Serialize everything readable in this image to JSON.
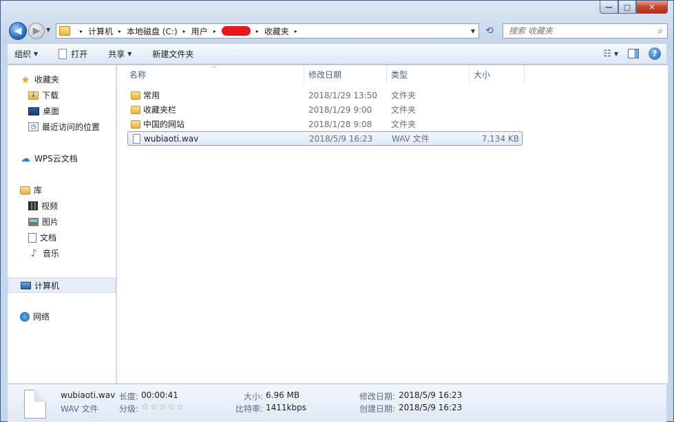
{
  "window": {
    "min_label": "—",
    "max_label": "□",
    "close_label": "✕"
  },
  "nav": {
    "back_icon": "◀",
    "forward_icon": "▶",
    "history_icon": "▼"
  },
  "address": {
    "crumbs": [
      "计算机",
      "本地磁盘 (C:)",
      "用户",
      "收藏夹"
    ],
    "separator": "▸",
    "dropdown_icon": "▼"
  },
  "refresh_icon": "⟲",
  "search": {
    "placeholder": "搜索 收藏夹",
    "icon": "⌕"
  },
  "toolbar": {
    "organize": "组织",
    "open": "打开",
    "share": "共享",
    "new_folder": "新建文件夹",
    "caret": "▼",
    "view_icon": "☷",
    "help_icon": "?"
  },
  "sidebar": {
    "favorites": "收藏夹",
    "downloads": "下载",
    "desktop": "桌面",
    "recent": "最近访问的位置",
    "wps": "WPS云文档",
    "libraries": "库",
    "videos": "视频",
    "pictures": "图片",
    "documents": "文档",
    "music": "音乐",
    "computer": "计算机",
    "network": "网络"
  },
  "columns": {
    "name": "名称",
    "modified": "修改日期",
    "type": "类型",
    "size": "大小",
    "sort_icon": "^"
  },
  "files": [
    {
      "name": "常用",
      "modified": "2018/1/29 13:50",
      "type": "文件夹",
      "size": ""
    },
    {
      "name": "收藏夹栏",
      "modified": "2018/1/29 9:00",
      "type": "文件夹",
      "size": ""
    },
    {
      "name": "中国的网站",
      "modified": "2018/1/28 9:08",
      "type": "文件夹",
      "size": ""
    },
    {
      "name": "wubiaoti.wav",
      "modified": "2018/5/9 16:23",
      "type": "WAV 文件",
      "size": "7,134 KB"
    }
  ],
  "details": {
    "filename": "wubiaoti.wav",
    "filetype": "WAV 文件",
    "length_label": "长度:",
    "length_value": "00:00:41",
    "rating_label": "分级:",
    "rating_stars": "☆☆☆☆☆",
    "size_label": "大小:",
    "size_value": "6.96 MB",
    "bitrate_label": "比特率:",
    "bitrate_value": "1411kbps",
    "modified_label": "修改日期:",
    "modified_value": "2018/5/9 16:23",
    "created_label": "创建日期:",
    "created_value": "2018/5/9 16:23"
  }
}
